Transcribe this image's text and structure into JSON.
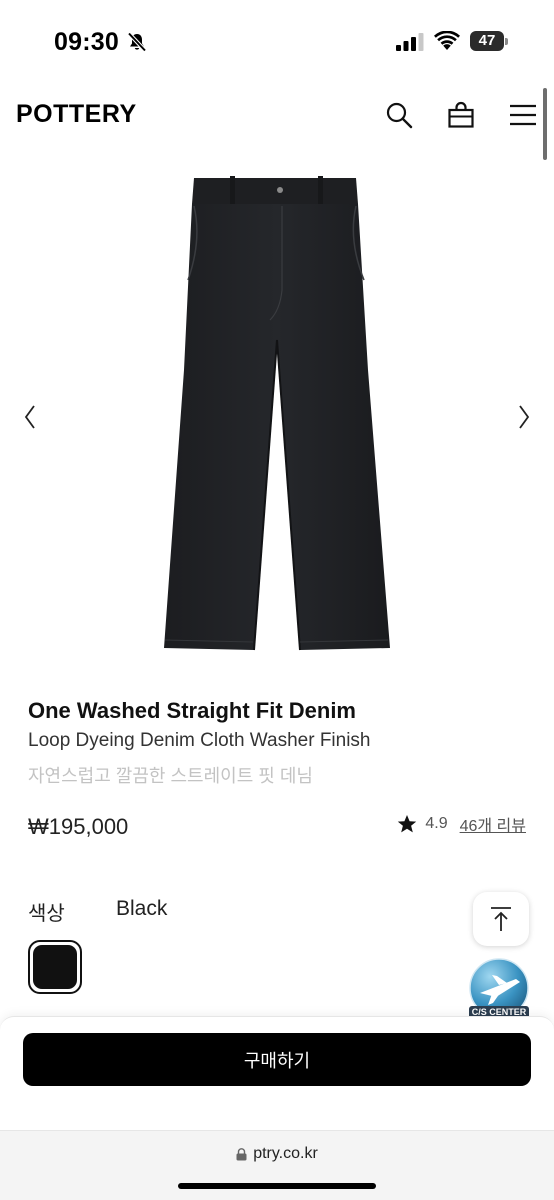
{
  "status_bar": {
    "time": "09:30",
    "battery": "47"
  },
  "header": {
    "logo": "POTTERY"
  },
  "product": {
    "title": "One Washed Straight Fit Denim",
    "subtitle": "Loop Dyeing Denim Cloth Washer Finish",
    "subtitle_ko": "자연스럽고 깔끔한 스트레이트 핏 데님",
    "price": "₩195,000",
    "rating": "4.9",
    "reviews": "46개 리뷰",
    "color_label": "색상",
    "color_value": "Black",
    "swatch_color": "#111111"
  },
  "cs_badge": {
    "label": "C/S CENTER"
  },
  "buy": {
    "label": "구매하기"
  },
  "browser": {
    "url": "ptry.co.kr"
  },
  "icons": [
    "bell-slash-icon",
    "signal-icon",
    "wifi-icon",
    "search-icon",
    "bag-icon",
    "menu-icon",
    "chevron-left-icon",
    "chevron-right-icon",
    "star-icon",
    "scroll-top-icon",
    "airplane-icon",
    "lock-icon"
  ]
}
